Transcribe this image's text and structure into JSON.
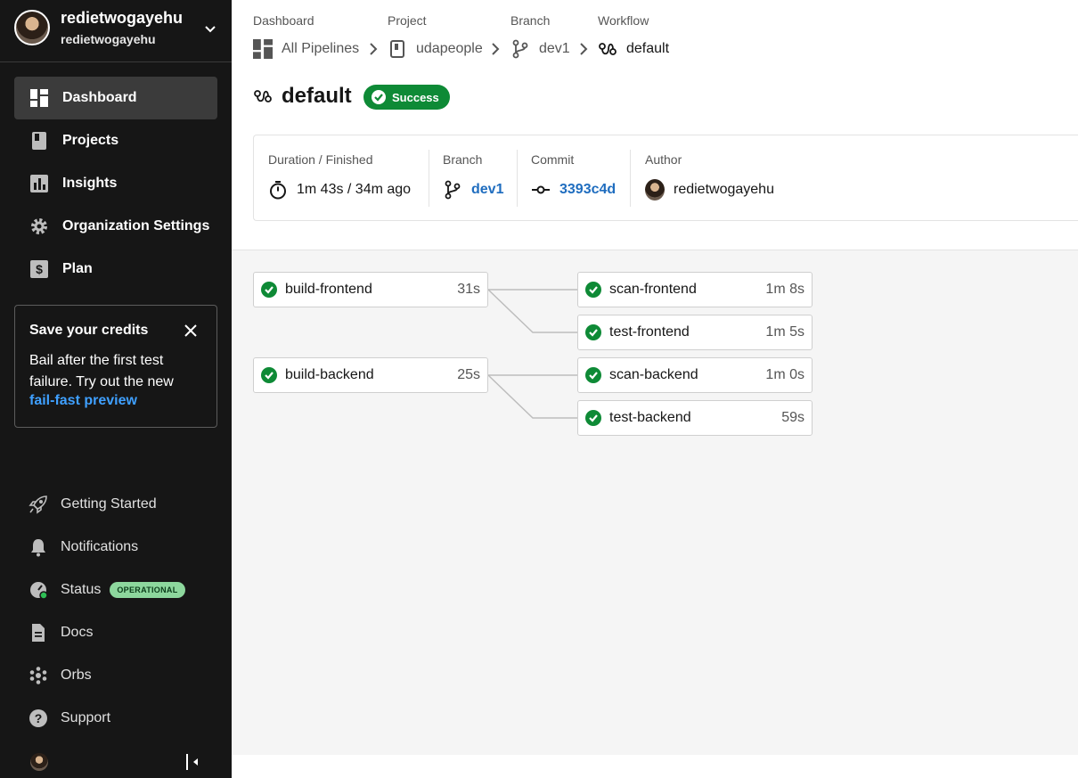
{
  "org": {
    "name": "redietwogayehu",
    "sub": "redietwogayehu"
  },
  "nav": [
    {
      "label": "Dashboard",
      "icon": "dashboard-icon",
      "active": true
    },
    {
      "label": "Projects",
      "icon": "projects-icon"
    },
    {
      "label": "Insights",
      "icon": "insights-icon"
    },
    {
      "label": "Organization Settings",
      "icon": "gear-icon"
    },
    {
      "label": "Plan",
      "icon": "dollar-icon"
    }
  ],
  "credits": {
    "title": "Save your credits",
    "body": "Bail after the first test failure. Try out the new",
    "link": "fail-fast preview"
  },
  "bottom_nav": [
    {
      "label": "Getting Started",
      "icon": "rocket-icon"
    },
    {
      "label": "Notifications",
      "icon": "bell-icon"
    },
    {
      "label": "Status",
      "icon": "status-icon",
      "badge": "OPERATIONAL"
    },
    {
      "label": "Docs",
      "icon": "doc-icon"
    },
    {
      "label": "Orbs",
      "icon": "orbs-icon"
    },
    {
      "label": "Support",
      "icon": "help-icon"
    }
  ],
  "breadcrumb": {
    "labels": [
      "Dashboard",
      "Project",
      "Branch",
      "Workflow"
    ],
    "items": [
      "All Pipelines",
      "udapeople",
      "dev1",
      "default"
    ]
  },
  "workflow": {
    "title": "default",
    "status": "Success"
  },
  "info": {
    "duration_label": "Duration / Finished",
    "duration_value": "1m 43s / 34m ago",
    "branch_label": "Branch",
    "branch_value": "dev1",
    "commit_label": "Commit",
    "commit_value": "3393c4d",
    "author_label": "Author",
    "author_value": "redietwogayehu"
  },
  "jobs": [
    {
      "name": "build-frontend",
      "duration": "31s"
    },
    {
      "name": "scan-frontend",
      "duration": "1m 8s"
    },
    {
      "name": "test-frontend",
      "duration": "1m 5s"
    },
    {
      "name": "build-backend",
      "duration": "25s"
    },
    {
      "name": "scan-backend",
      "duration": "1m 0s"
    },
    {
      "name": "test-backend",
      "duration": "59s"
    }
  ],
  "colors": {
    "sidebar_bg": "#161616",
    "success": "#0e8a36",
    "link": "#1f6dbf",
    "operational": "#8dd79d"
  }
}
